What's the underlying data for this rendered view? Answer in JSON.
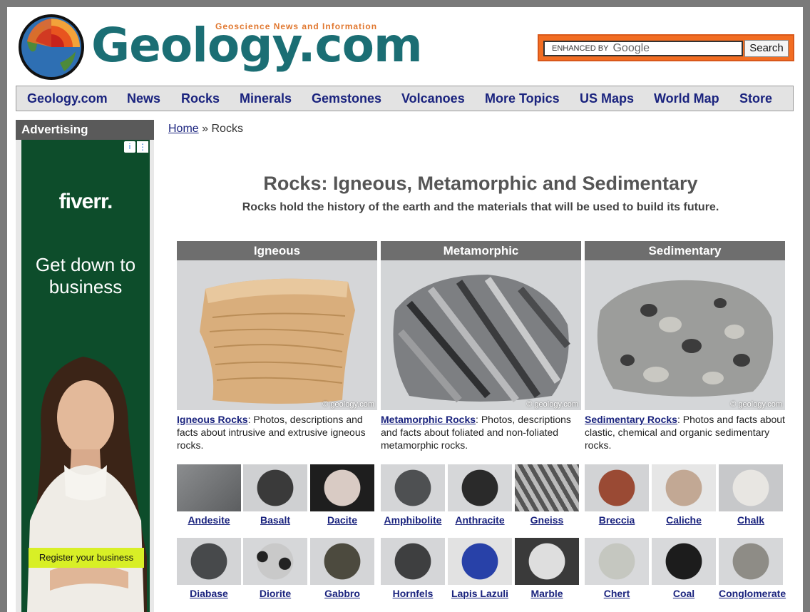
{
  "site": {
    "logo_text": "Geology.com",
    "tagline": "Geoscience News and Information",
    "colors": {
      "logo": "#1b6e74",
      "tagline": "#e0762d",
      "nav_link": "#1a237e",
      "search_border": "#f26d22"
    }
  },
  "search": {
    "enhanced_by": "ENHANCED BY",
    "provider": "Google",
    "button_label": "Search"
  },
  "nav": {
    "items": [
      "Geology.com",
      "News",
      "Rocks",
      "Minerals",
      "Gemstones",
      "Volcanoes",
      "More Topics",
      "US Maps",
      "World Map",
      "Store"
    ]
  },
  "ad": {
    "header": "Advertising",
    "brand": "fiverr.",
    "tagline": "Get down to business",
    "cta": "Register your business",
    "icons": [
      "info-icon",
      "menu-dots-icon"
    ]
  },
  "breadcrumb": {
    "home": "Home",
    "separator": "»",
    "current": "Rocks"
  },
  "main": {
    "title": "Rocks: Igneous, Metamorphic and Sedimentary",
    "subtitle": "Rocks hold the history of the earth and the materials that will be used to build its future.",
    "categories": [
      {
        "heading": "Igneous",
        "link": "Igneous Rocks",
        "text": ": Photos, descriptions and facts about intrusive and extrusive igneous rocks.",
        "watermark": "© geology.com"
      },
      {
        "heading": "Metamorphic",
        "link": "Metamorphic Rocks",
        "text": ": Photos, descriptions and facts about foliated and non-foliated metamorphic rocks.",
        "watermark": "© geology.com"
      },
      {
        "heading": "Sedimentary",
        "link": "Sedimentary Rocks",
        "text": ": Photos and facts about clastic, chemical and organic sedimentary rocks.",
        "watermark": "© geology.com"
      }
    ],
    "rocks_row1": [
      "Andesite",
      "Basalt",
      "Dacite",
      "Amphibolite",
      "Anthracite",
      "Gneiss",
      "Breccia",
      "Caliche",
      "Chalk"
    ],
    "rocks_row2": [
      "Diabase",
      "Diorite",
      "Gabbro",
      "Hornfels",
      "Lapis Lazuli",
      "Marble",
      "Chert",
      "Coal",
      "Conglomerate"
    ]
  }
}
